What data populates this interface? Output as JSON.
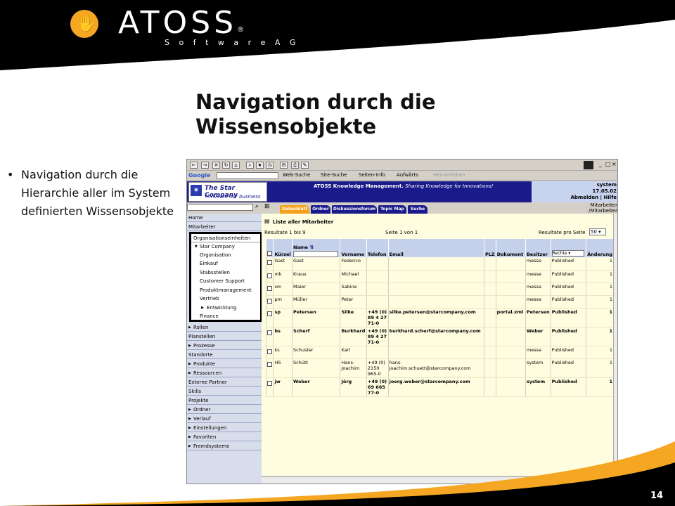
{
  "logo": {
    "brand": "ATOSS",
    "registered": "®",
    "subtitle": "S o f t w a r e A G"
  },
  "slide": {
    "title": "Navigation durch die Wissensobjekte",
    "bullet": "Navigation durch die Hierarchie aller im System definierten Wissensobjekte",
    "page_number": "14"
  },
  "browser": {
    "google_label": "Google",
    "web_search": "Web-Suche",
    "site_search": "Site-Suche",
    "page_info": "Seiten-Info",
    "up": "Aufwärts",
    "highlight": "Hervorheben"
  },
  "app": {
    "company_name": "The Star Company",
    "company_slogan": "Thrive on our business",
    "header_brand": "ATOSS Knowledge Management.",
    "header_tagline": "Sharing Knowledge for Innovations!",
    "user": "system",
    "date": "17.05.02",
    "logout": "Abmelden",
    "separator": "|",
    "help": "Hilfe",
    "context_line1": "Mitarbeiter",
    "context_line2": "/Mitarbeiter",
    "tabs": [
      {
        "label": "Datenblatt"
      },
      {
        "label": "Ordner"
      },
      {
        "label": "Diskussionsforum"
      },
      {
        "label": "Topic Map"
      },
      {
        "label": "Suche"
      }
    ]
  },
  "sidebar": {
    "items_top": [
      {
        "label": "Home"
      },
      {
        "label": "Mitarbeiter"
      }
    ],
    "highlight": [
      {
        "label": "Organisationseinheiten"
      },
      {
        "label": "Star Company"
      },
      {
        "label": "Organisation"
      },
      {
        "label": "Einkauf"
      },
      {
        "label": "Stabsstellen"
      },
      {
        "label": "Customer Support"
      },
      {
        "label": "Produktmanagement"
      },
      {
        "label": "Vertrieb"
      },
      {
        "label": "Entwicklung"
      },
      {
        "label": "Finance"
      }
    ],
    "items_bottom": [
      {
        "label": "Rollen",
        "sub": true
      },
      {
        "label": "Planstellen",
        "sub": false
      },
      {
        "label": "Prozesse",
        "sub": true
      },
      {
        "label": "Standorte",
        "sub": false
      },
      {
        "label": "Produkte",
        "sub": true
      },
      {
        "label": "Ressourcen",
        "sub": true
      },
      {
        "label": "Externe Partner",
        "sub": false
      },
      {
        "label": "Skills",
        "sub": false
      },
      {
        "label": "Projekte",
        "sub": false
      },
      {
        "label": "Ordner",
        "sub": true
      },
      {
        "label": "Verlauf",
        "sub": true
      },
      {
        "label": "Einstellungen",
        "sub": true
      },
      {
        "label": "Favoriten",
        "sub": true
      },
      {
        "label": "Fremdsysteme",
        "sub": true
      }
    ]
  },
  "list": {
    "title": "Liste aller Mitarbeiter",
    "results": "Resultate 1 bis 9",
    "page": "Seite 1 von 1",
    "per_page_label": "Resultate pro Seite",
    "per_page_value": "50",
    "rights_filter": "Rechte",
    "columns": [
      "Kürzel",
      "Name",
      "Vorname",
      "Telefon",
      "Email",
      "PLZ",
      "Dokument",
      "Besitzer",
      "",
      "Änderung"
    ],
    "rows": [
      {
        "bold": false,
        "cells": [
          "Gast",
          "Gast",
          "Federico",
          "",
          "",
          "",
          "",
          "messe",
          "Published",
          "1"
        ]
      },
      {
        "bold": false,
        "cells": [
          "mk",
          "Kraus",
          "Michael",
          "",
          "",
          "",
          "",
          "messe",
          "Published",
          "1"
        ]
      },
      {
        "bold": false,
        "cells": [
          "sm",
          "Maier",
          "Sabine",
          "",
          "",
          "",
          "",
          "messe",
          "Published",
          "1"
        ]
      },
      {
        "bold": false,
        "cells": [
          "pm",
          "Müller",
          "Peter",
          "",
          "",
          "",
          "",
          "messe",
          "Published",
          "1"
        ]
      },
      {
        "bold": true,
        "cells": [
          "sp",
          "Petersen",
          "Silke",
          "+49 (0) 89 4 27 71-0",
          "silke.petersen@starcompany.com",
          "",
          "portal.xml",
          "Petersen",
          "Published",
          "1"
        ]
      },
      {
        "bold": true,
        "cells": [
          "bs",
          "Scherf",
          "Burkhard",
          "+49 (0) 89 4 27 71-0",
          "burkhard.scherf@starcompany.com",
          "",
          "",
          "Weber",
          "Published",
          "1"
        ]
      },
      {
        "bold": false,
        "cells": [
          "ks",
          "Schuster",
          "Karl",
          "",
          "",
          "",
          "",
          "messe",
          "Published",
          "1"
        ]
      },
      {
        "bold": false,
        "cells": [
          "HS",
          "Schütt",
          "Hans-Joachim",
          "+49 (0) 2150 965-0",
          "hans-joachim.schuett@starcompany.com",
          "",
          "",
          "system",
          "Published",
          "1"
        ]
      },
      {
        "bold": true,
        "cells": [
          "jw",
          "Weber",
          "Jörg",
          "+49 (0) 69 665 77-0",
          "joerg.weber@starcompany.com",
          "",
          "",
          "system",
          "Published",
          "1"
        ]
      }
    ]
  },
  "colors": {
    "slide_black": "#000000",
    "slide_accent": "#f5a623",
    "app_navy": "#1a1a8a",
    "active_tab": "#f4a21a",
    "content_bg": "#fffde0"
  }
}
